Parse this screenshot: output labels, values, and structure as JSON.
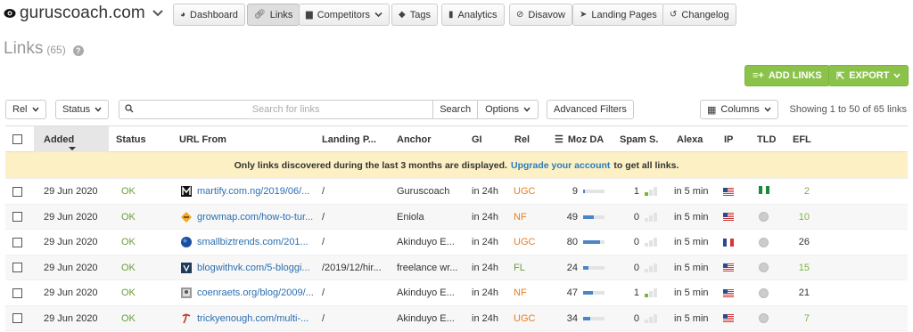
{
  "site": {
    "name": "guruscoach.com"
  },
  "nav": [
    {
      "label": "Dashboard",
      "icon": "dashboard-icon",
      "active": false
    },
    {
      "label": "Links",
      "icon": "link-icon",
      "active": true
    },
    {
      "label": "Competitors",
      "icon": "competitors-icon",
      "active": false
    },
    {
      "label": "Tags",
      "icon": "tag-icon",
      "active": false
    },
    {
      "label": "Analytics",
      "icon": "analytics-icon",
      "active": false
    },
    {
      "label": "Disavow",
      "icon": "disavow-icon",
      "active": false
    },
    {
      "label": "Landing Pages",
      "icon": "send-icon",
      "active": false
    },
    {
      "label": "Changelog",
      "icon": "history-icon",
      "active": false
    }
  ],
  "page": {
    "title": "Links",
    "count": "(65)"
  },
  "actions": {
    "add_links": "ADD LINKS",
    "export": "EXPORT"
  },
  "filters": {
    "rel": "Rel",
    "status": "Status",
    "search_placeholder": "Search for links",
    "search_btn": "Search",
    "options": "Options",
    "advanced": "Advanced Filters",
    "columns": "Columns",
    "showing": "Showing 1 to 50 of 65 links"
  },
  "columns": {
    "added": "Added",
    "status": "Status",
    "url_from": "URL From",
    "landing": "Landing P...",
    "anchor": "Anchor",
    "gi": "GI",
    "rel": "Rel",
    "moz": "Moz DA",
    "spam": "Spam S.",
    "alexa": "Alexa",
    "ip": "IP",
    "tld": "TLD",
    "efl": "EFL"
  },
  "notice": {
    "text": "Only links discovered during the last 3 months are displayed.",
    "link": "Upgrade your account",
    "suffix": "to get all links."
  },
  "colors": {
    "accent": "#8bc34a",
    "link": "#2b6fb0",
    "notice_bg": "#fcf0c4"
  },
  "rows": [
    {
      "added": "29 Jun 2020",
      "status": "OK",
      "url": "martify.com.ng/2019/06/...",
      "landing": "/",
      "anchor": "Guruscoach",
      "gi": "in 24h",
      "rel": "UGC",
      "moz": "9",
      "moz_level": 0.09,
      "spam": "1",
      "spam_level": 1,
      "alexa": "in 5 min",
      "ip": "us-flag",
      "tld": "ng-flag",
      "efl": "2",
      "efl_green": true,
      "favicon": "m"
    },
    {
      "added": "29 Jun 2020",
      "status": "OK",
      "url": "growmap.com/how-to-tur...",
      "landing": "/",
      "anchor": "Eniola",
      "gi": "in 24h",
      "rel": "NF",
      "moz": "49",
      "moz_level": 0.49,
      "spam": "0",
      "spam_level": 0,
      "alexa": "in 5 min",
      "ip": "us-flag",
      "tld": "globe",
      "efl": "10",
      "efl_green": true,
      "favicon": "g"
    },
    {
      "added": "29 Jun 2020",
      "status": "OK",
      "url": "smallbiztrends.com/201...",
      "landing": "/",
      "anchor": "Akinduyo E...",
      "gi": "in 24h",
      "rel": "UGC",
      "moz": "80",
      "moz_level": 0.8,
      "spam": "0",
      "spam_level": 0,
      "alexa": "in 5 min",
      "ip": "fr-flag",
      "tld": "globe",
      "efl": "26",
      "efl_green": false,
      "favicon": "s"
    },
    {
      "added": "29 Jun 2020",
      "status": "OK",
      "url": "blogwithvk.com/5-bloggi...",
      "landing": "/2019/12/hir...",
      "anchor": "freelance wr...",
      "gi": "in 24h",
      "rel": "FL",
      "moz": "24",
      "moz_level": 0.24,
      "spam": "0",
      "spam_level": 0,
      "alexa": "in 5 min",
      "ip": "us-flag",
      "tld": "globe",
      "efl": "15",
      "efl_green": true,
      "favicon": "b"
    },
    {
      "added": "29 Jun 2020",
      "status": "OK",
      "url": "coenraets.org/blog/2009/...",
      "landing": "/",
      "anchor": "Akinduyo E...",
      "gi": "in 24h",
      "rel": "NF",
      "moz": "47",
      "moz_level": 0.47,
      "spam": "1",
      "spam_level": 1,
      "alexa": "in 5 min",
      "ip": "us-flag",
      "tld": "globe",
      "efl": "21",
      "efl_green": false,
      "favicon": "c"
    },
    {
      "added": "29 Jun 2020",
      "status": "OK",
      "url": "trickyenough.com/multi-...",
      "landing": "/",
      "anchor": "Akinduyo E...",
      "gi": "in 24h",
      "rel": "UGC",
      "moz": "34",
      "moz_level": 0.34,
      "spam": "0",
      "spam_level": 0,
      "alexa": "in 5 min",
      "ip": "us-flag",
      "tld": "globe",
      "efl": "7",
      "efl_green": true,
      "favicon": "t"
    }
  ]
}
